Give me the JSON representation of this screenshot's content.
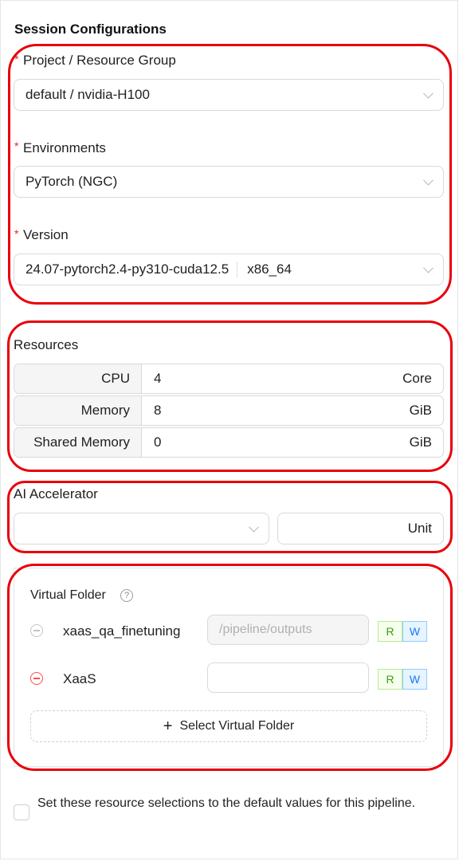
{
  "section_title": "Session Configurations",
  "project": {
    "label": "Project / Resource Group",
    "value": "default / nvidia-H100"
  },
  "environment": {
    "label": "Environments",
    "value": "PyTorch (NGC)"
  },
  "version": {
    "label": "Version",
    "value": "24.07-pytorch2.4-py310-cuda12.5",
    "arch": "x86_64"
  },
  "resources": {
    "label": "Resources",
    "rows": [
      {
        "name": "CPU",
        "value": "4",
        "unit": "Core"
      },
      {
        "name": "Memory",
        "value": "8",
        "unit": "GiB"
      },
      {
        "name": "Shared Memory",
        "value": "0",
        "unit": "GiB"
      }
    ]
  },
  "accelerator": {
    "label": "AI Accelerator",
    "type_value": "",
    "unit": "Unit"
  },
  "virtual_folder": {
    "label": "Virtual Folder",
    "items": [
      {
        "name": "xaas_qa_finetuning",
        "path_placeholder": "/pipeline/outputs",
        "path_value": "",
        "r": "R",
        "w": "W"
      },
      {
        "name": "XaaS",
        "path_placeholder": "",
        "path_value": "",
        "r": "R",
        "w": "W"
      }
    ],
    "add_button": "Select Virtual Folder"
  },
  "default_checkbox": {
    "label": "Set these resource selections to the default values for this pipeline.",
    "checked": false
  },
  "colors": {
    "annotation_red": "#e8000b",
    "required_red": "#e32424",
    "remove_red": "#ff4d4f",
    "read_green": "#52c41a",
    "write_blue": "#1677ff"
  }
}
